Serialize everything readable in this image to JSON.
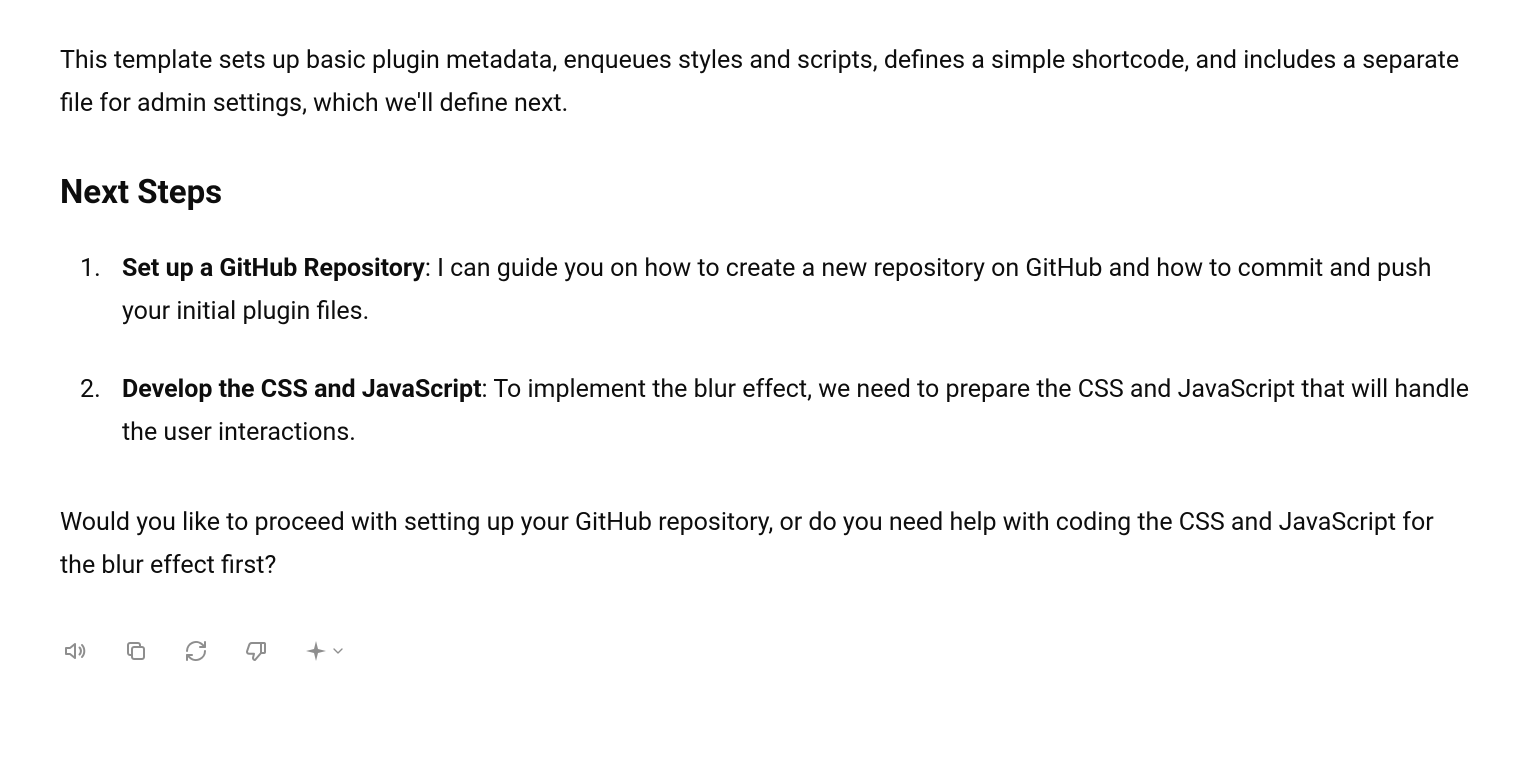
{
  "intro": "This template sets up basic plugin metadata, enqueues styles and scripts, defines a simple shortcode, and includes a separate file for admin settings, which we'll define next.",
  "heading": "Next Steps",
  "steps": [
    {
      "title": "Set up a GitHub Repository",
      "body": ": I can guide you on how to create a new repository on GitHub and how to commit and push your initial plugin files."
    },
    {
      "title": "Develop the CSS and JavaScript",
      "body": ": To implement the blur effect, we need to prepare the CSS and JavaScript that will handle the user interactions."
    }
  ],
  "closing": "Would you like to proceed with setting up your GitHub repository, or do you need help with coding the CSS and JavaScript for the blur effect first?",
  "icons": {
    "speaker": "speaker-icon",
    "copy": "copy-icon",
    "regenerate": "regenerate-icon",
    "thumbs_down": "thumbs-down-icon",
    "sparkle": "sparkle-icon",
    "chevron": "chevron-down-icon"
  }
}
